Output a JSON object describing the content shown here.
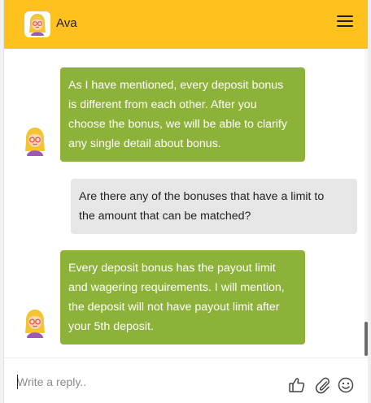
{
  "header": {
    "agent_name": "Ava"
  },
  "messages": [
    {
      "from": "bot",
      "lines": [
        "As I have mentioned, every deposit bonus",
        "is different from each other. After you",
        "choose the bonus, we will be able to clarify",
        "any single detail about bonus."
      ]
    },
    {
      "from": "user",
      "lines": [
        "Are there any of the bonuses that have a limit to",
        "the amount that can be matched?"
      ]
    },
    {
      "from": "bot",
      "lines": [
        "Every deposit bonus has the payout limit",
        "and wagering requirements. I will mention,",
        "the deposit will not have payout limit after",
        "your 5th deposit."
      ]
    }
  ],
  "composer": {
    "placeholder": "Write a reply.."
  },
  "icons": {
    "menu": "hamburger-menu-icon",
    "like": "thumbs-up-icon",
    "attach": "paperclip-icon",
    "emoji": "smiley-icon"
  },
  "colors": {
    "header": "#ffc11e",
    "bot_bubble": "#8cb23a",
    "user_bubble": "#e6e6e6"
  }
}
